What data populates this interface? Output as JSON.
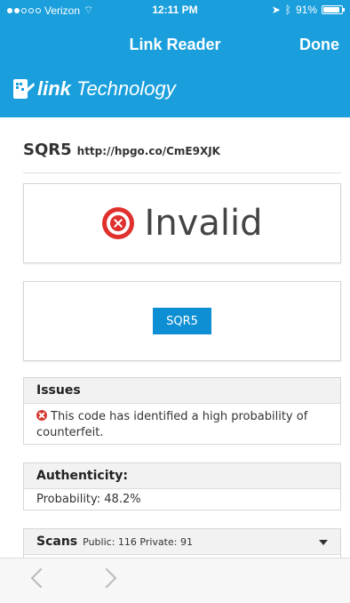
{
  "status_bar": {
    "carrier": "Verizon",
    "time": "12:11 PM",
    "battery": "91%"
  },
  "nav": {
    "title": "Link Reader",
    "done_label": "Done"
  },
  "brand": {
    "link": "link",
    "technology": "Technology"
  },
  "result": {
    "code": "SQR5",
    "url": "http://hpgo.co/CmE9XJK",
    "status": "Invalid",
    "button_label": "SQR5"
  },
  "issues": {
    "title": "Issues",
    "message": "This code has identified a high probability of counterfeit."
  },
  "authenticity": {
    "title": "Authenticity:",
    "probability": "Probability: 48.2%"
  },
  "scans": {
    "title": "Scans",
    "summary": "Public: 116 Private: 91"
  },
  "colors": {
    "brand_blue": "#1a9fdc",
    "button_blue": "#0f8fd3",
    "invalid_red": "#e0302d"
  }
}
